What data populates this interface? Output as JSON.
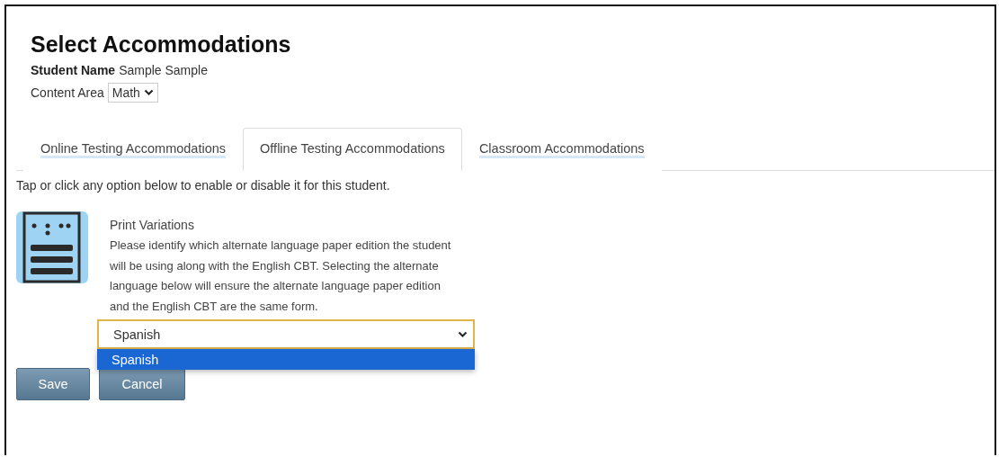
{
  "title": "Select Accommodations",
  "student": {
    "label": "Student Name",
    "value": "Sample Sample"
  },
  "content_area": {
    "label": "Content Area",
    "value": "Math"
  },
  "tabs": [
    {
      "label": "Online Testing Accommodations",
      "selected": false
    },
    {
      "label": "Offline Testing Accommodations",
      "selected": true
    },
    {
      "label": "Classroom Accommodations",
      "selected": false
    }
  ],
  "instruction": "Tap or click any option below to enable or disable it for this student.",
  "accommodation": {
    "name": "Print Variations",
    "description": "Please identify which alternate language paper edition the student will be using along with the English CBT. Selecting the alternate language below will ensure the alternate language paper edition and the English CBT are the same form.",
    "select": {
      "value": "Spanish",
      "expanded": true,
      "options": [
        {
          "label": "Spanish",
          "selected": true
        }
      ]
    }
  },
  "buttons": [
    "Save",
    "Cancel"
  ]
}
